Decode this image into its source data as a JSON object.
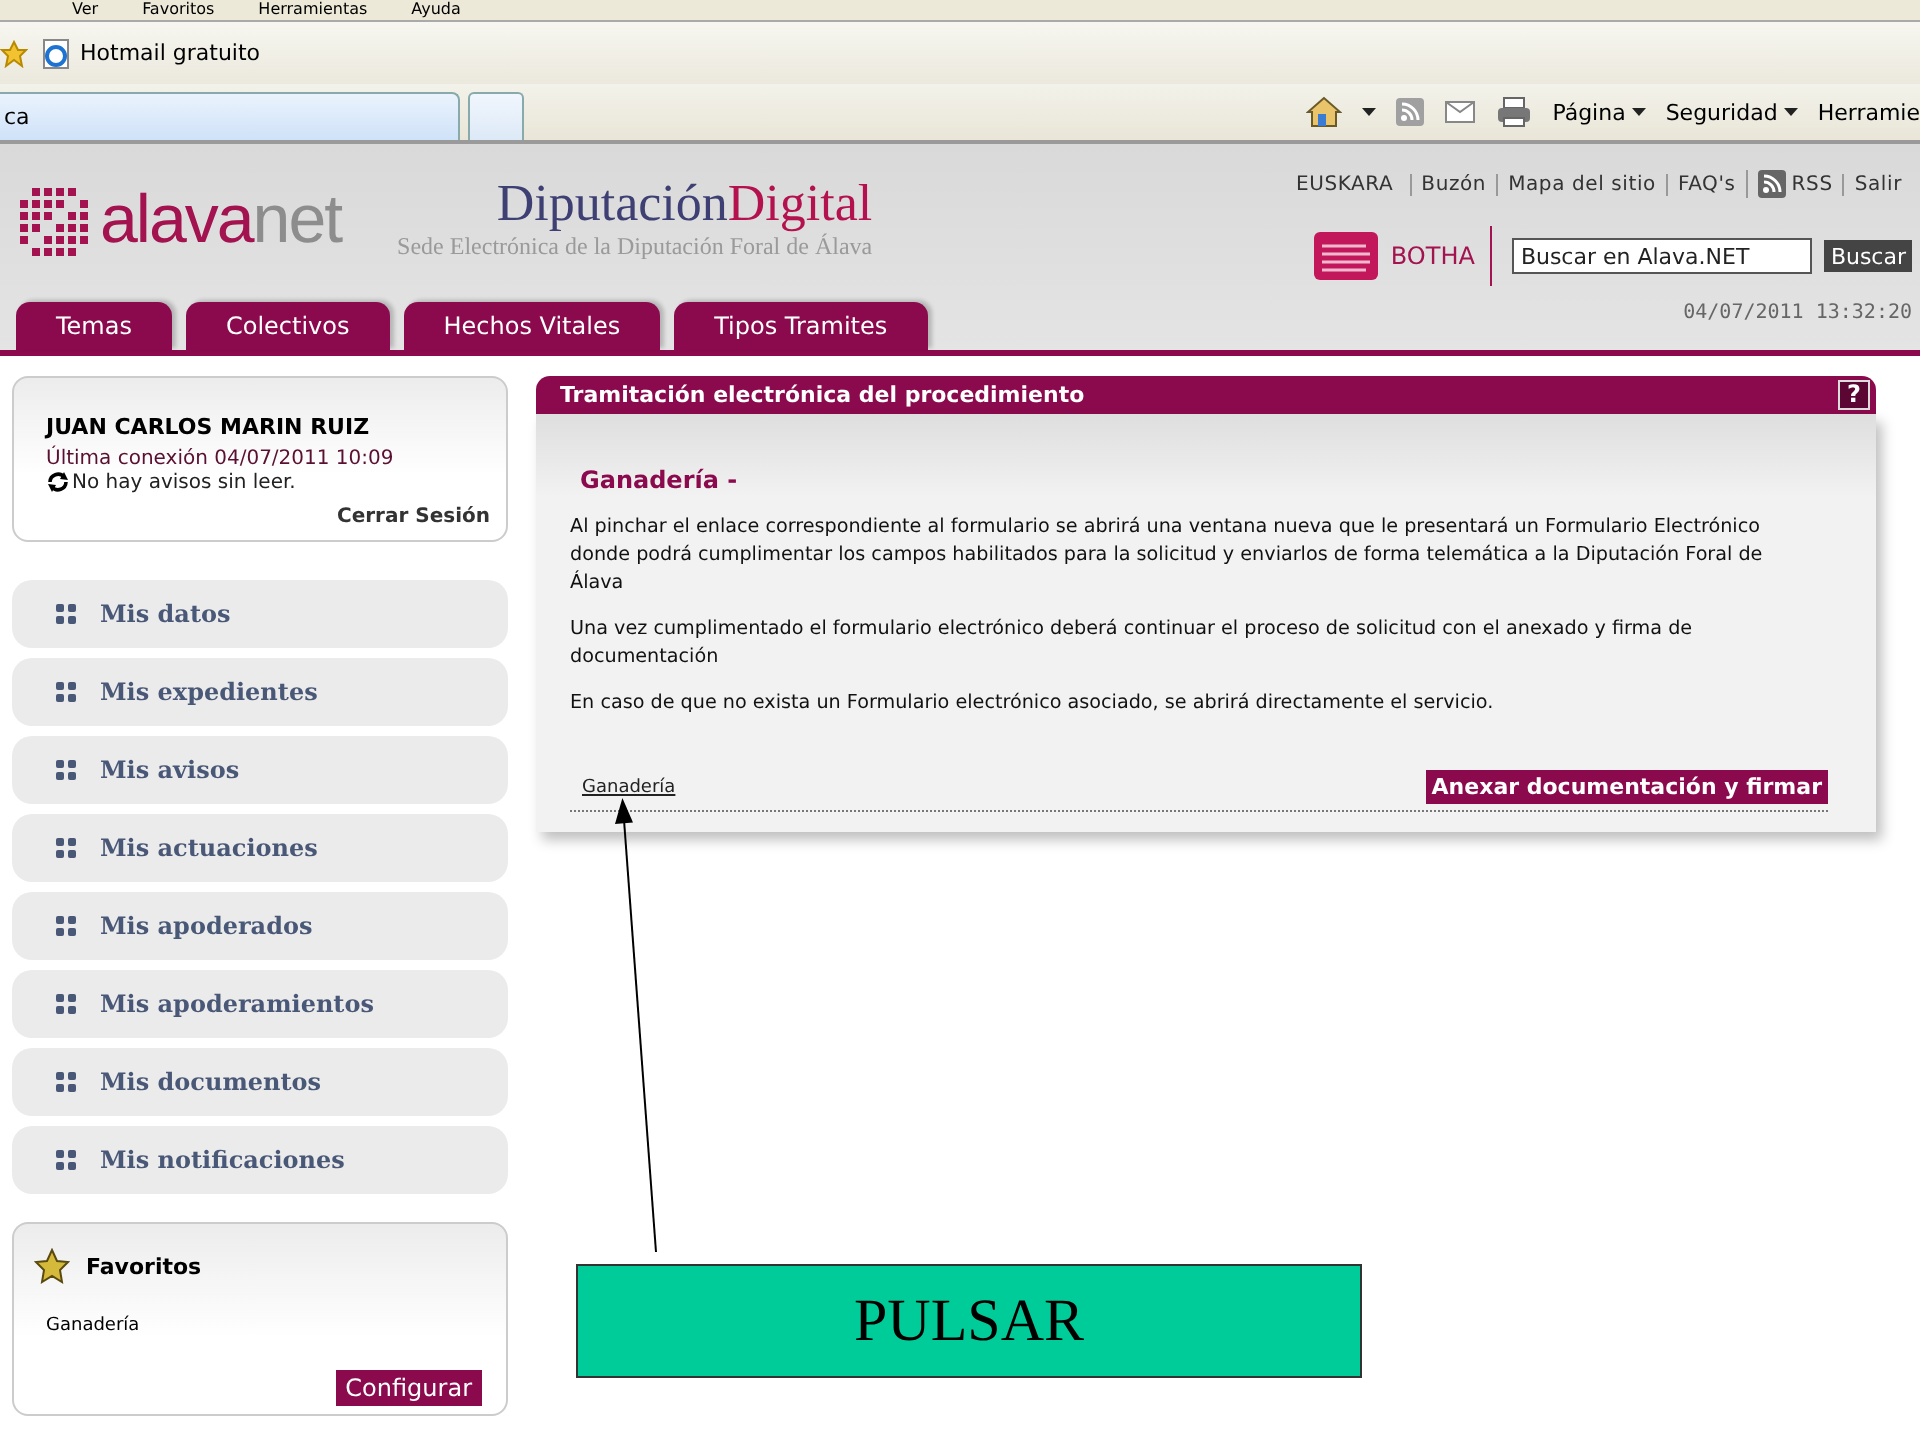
{
  "browser": {
    "menu": [
      "Ver",
      "Favoritos",
      "Herramientas",
      "Ayuda"
    ],
    "favorites": [
      "Hotmail gratuito"
    ],
    "tab": {
      "title": "ca"
    },
    "toolbar": [
      "Página",
      "Seguridad",
      "Herramie"
    ]
  },
  "header": {
    "logo": {
      "part_1": "alava",
      "part_2": "net"
    },
    "title": {
      "part_1": "Diputación",
      "part_2": "Digital"
    },
    "subtitle": "Sede Electrónica de la Diputación Foral de Álava",
    "top_links": [
      {
        "label": "EUSKARA",
        "kind": "text"
      },
      {
        "label": "Buzón",
        "kind": "text"
      },
      {
        "label": "Mapa del sitio",
        "kind": "text"
      },
      {
        "label": "FAQ's",
        "kind": "text"
      },
      {
        "label": "RSS",
        "kind": "rss"
      },
      {
        "label": "Salir",
        "kind": "text"
      }
    ],
    "botha": "BOTHA",
    "search": {
      "placeholder": "Buscar en Alava.NET",
      "button": "Buscar"
    },
    "datetime": "04/07/2011 13:32:20",
    "tabs": [
      {
        "label": "Temas",
        "selected": false
      },
      {
        "label": "Colectivos",
        "selected": false
      },
      {
        "label": "Hechos Vitales",
        "selected": false
      },
      {
        "label": "Tipos Tramites",
        "selected": false
      }
    ]
  },
  "user": {
    "name": "JUAN CARLOS MARIN RUIZ",
    "last_connection": "Última conexión 04/07/2011 10:09",
    "notices": "No hay avisos sin leer.",
    "logout": "Cerrar Sesión"
  },
  "sidebar": {
    "items": [
      "Mis datos",
      "Mis expedientes",
      "Mis avisos",
      "Mis actuaciones",
      "Mis apoderados",
      "Mis apoderamientos",
      "Mis documentos",
      "Mis notificaciones"
    ]
  },
  "favorites": {
    "title": "Favoritos",
    "items": [
      "Ganadería"
    ],
    "button": "Configurar"
  },
  "panel": {
    "title": "Tramitación electrónica del procedimiento",
    "help": "?",
    "heading": "Ganadería -",
    "paragraphs": [
      "Al pinchar el enlace correspondiente al formulario se abrirá una ventana nueva que le presentará un Formulario Electrónico donde podrá cumplimentar los campos habilitados para la solicitud y enviarlos de forma telemática a la Diputación Foral de Álava",
      "Una vez cumplimentado el formulario electrónico deberá continuar el proceso de solicitud con el anexado y firma de documentación",
      "En caso de que no exista un Formulario electrónico asociado, se abrirá directamente el servicio."
    ],
    "link": "Ganadería",
    "action": "Anexar documentación y firmar"
  },
  "annotation": {
    "text": "PULSAR"
  }
}
